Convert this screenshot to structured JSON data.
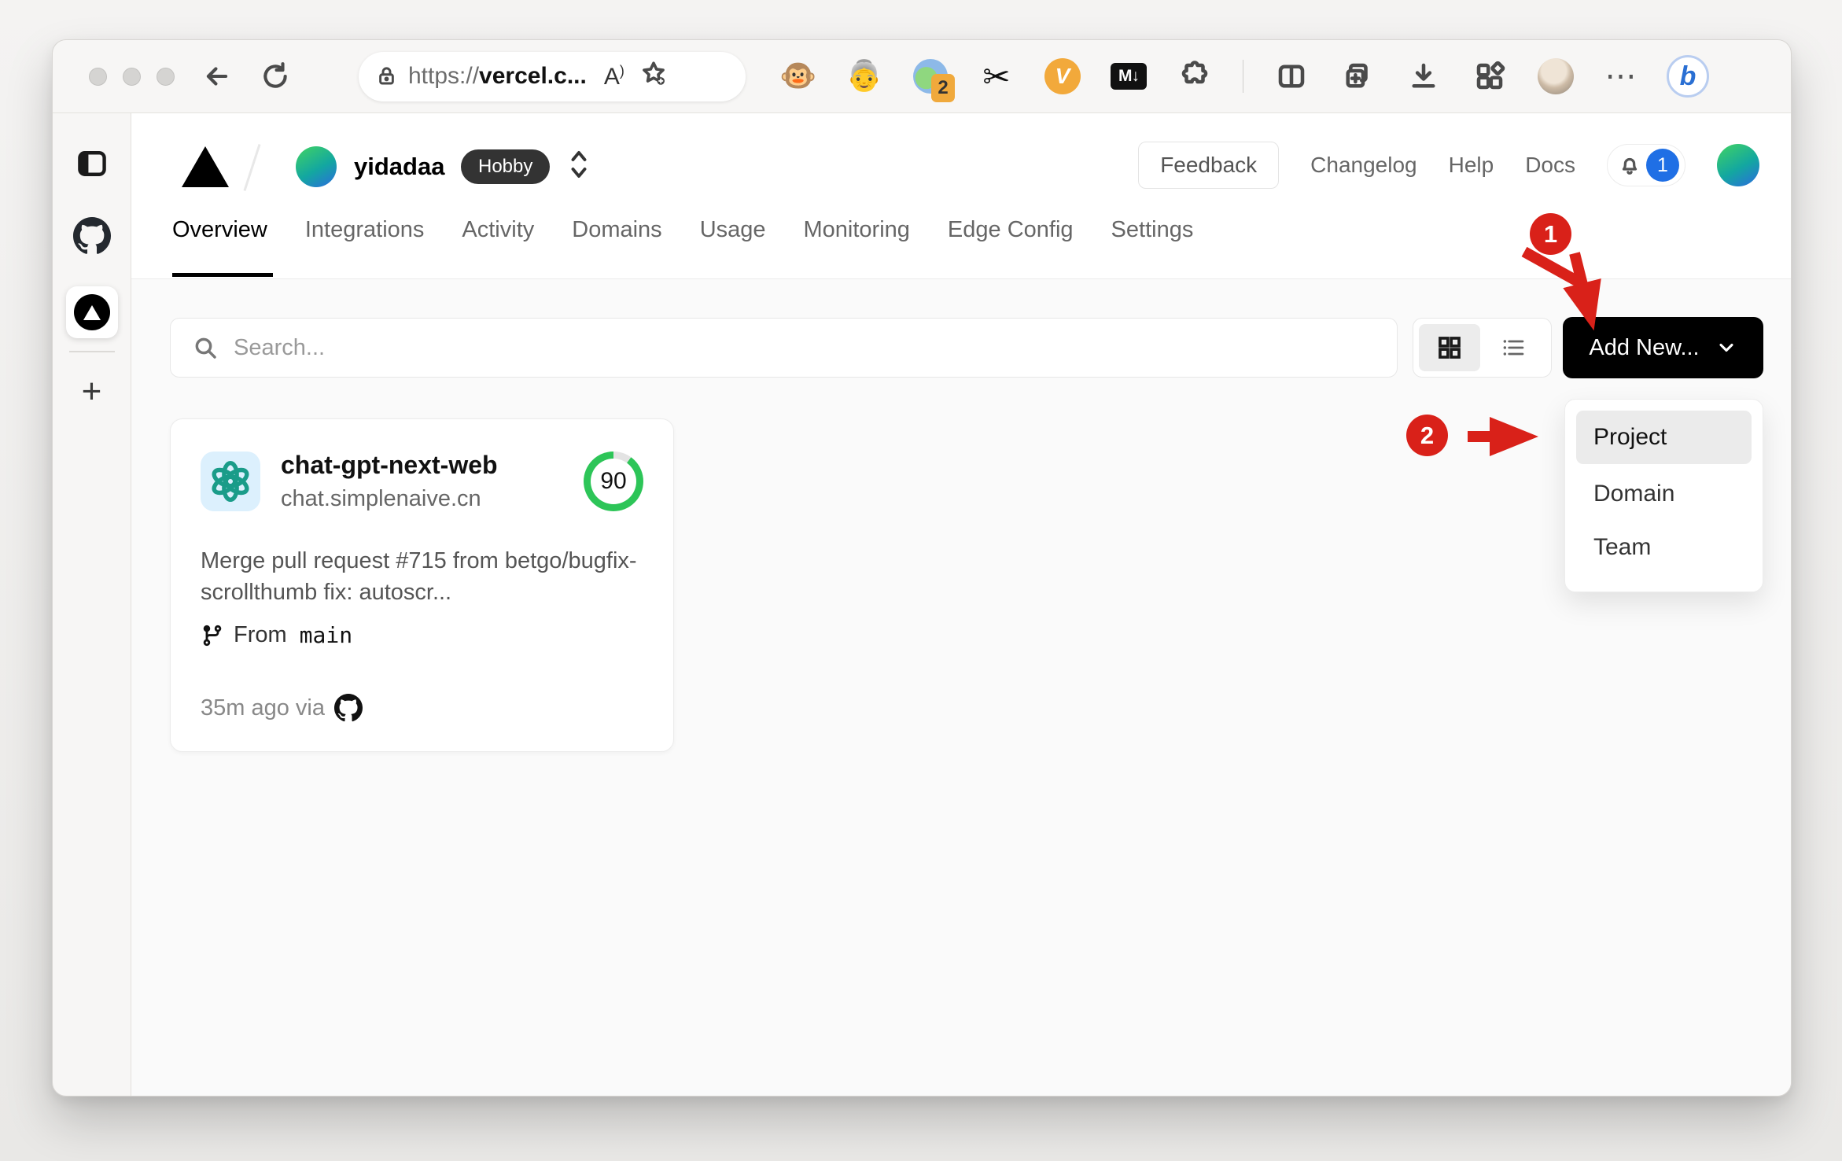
{
  "browser": {
    "url_scheme": "https://",
    "url_host": "vercel.c...",
    "read_aloud_label": "A",
    "extensions": {
      "monkey_glyph": "🐵",
      "person_glyph": "👵",
      "pie_badge": "2",
      "scissors_glyph": "✂",
      "v_label": "V",
      "markdown_label": "M↓",
      "more_glyph": "⋯",
      "bing_label": "b"
    }
  },
  "vertical_tabs": {
    "new_tab_glyph": "+"
  },
  "header": {
    "team_name": "yidadaa",
    "plan_badge": "Hobby",
    "feedback_label": "Feedback",
    "links": [
      {
        "label": "Changelog"
      },
      {
        "label": "Help"
      },
      {
        "label": "Docs"
      }
    ],
    "notification_count": "1"
  },
  "tabs": [
    {
      "label": "Overview",
      "active": true
    },
    {
      "label": "Integrations"
    },
    {
      "label": "Activity"
    },
    {
      "label": "Domains"
    },
    {
      "label": "Usage"
    },
    {
      "label": "Monitoring"
    },
    {
      "label": "Edge Config"
    },
    {
      "label": "Settings"
    }
  ],
  "toolbar": {
    "search_placeholder": "Search...",
    "add_new_label": "Add New..."
  },
  "dropdown": {
    "items": [
      {
        "label": "Project",
        "highlighted": true
      },
      {
        "label": "Domain"
      },
      {
        "label": "Team"
      }
    ]
  },
  "project_card": {
    "name": "chat-gpt-next-web",
    "domain": "chat.simplenaive.cn",
    "score": "90",
    "commit_message": "Merge pull request #715 from betgo/bugfix-scrollthumb fix: autoscr...",
    "branch_prefix": "From",
    "branch_name": "main",
    "deployed_meta": "35m ago via"
  },
  "annotations": {
    "step1": "1",
    "step2": "2"
  },
  "colors": {
    "annotation_red": "#d92119",
    "score_green": "#2dc558",
    "notification_blue": "#1f6fe5",
    "button_black": "#000000"
  }
}
